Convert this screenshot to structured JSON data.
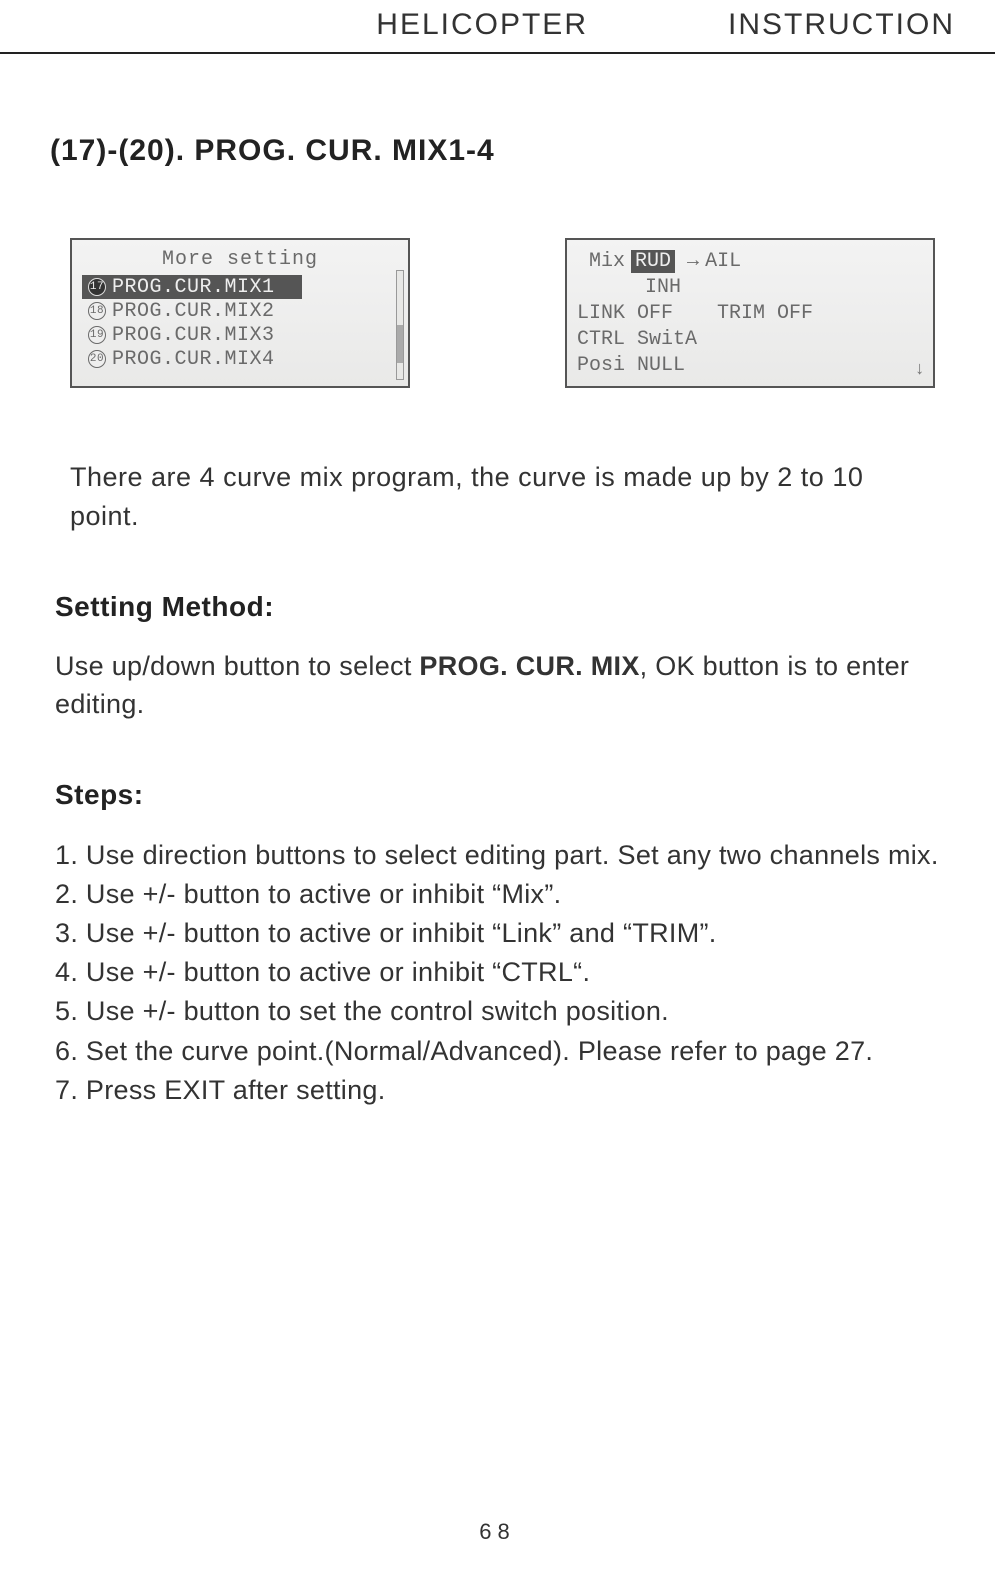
{
  "header": {
    "left": "HELICOPTER",
    "right": "INSTRUCTION"
  },
  "section_title": "(17)-(20). PROG. CUR. MIX1-4",
  "lcd_left": {
    "title": "More setting",
    "items": [
      {
        "idx": "17",
        "label": "PROG.CUR.MIX1",
        "selected": true
      },
      {
        "idx": "18",
        "label": "PROG.CUR.MIX2",
        "selected": false
      },
      {
        "idx": "19",
        "label": "PROG.CUR.MIX3",
        "selected": false
      },
      {
        "idx": "20",
        "label": "PROG.CUR.MIX4",
        "selected": false
      }
    ]
  },
  "lcd_right": {
    "mix_label": "Mix",
    "mix_from": "RUD",
    "mix_to": "AIL",
    "inh": "INH",
    "link_label": "LINK",
    "link_val": "OFF",
    "trim_label": "TRIM",
    "trim_val": "OFF",
    "ctrl_label": "CTRL",
    "ctrl_val": "SwitA",
    "posi_label": "Posi",
    "posi_val": "NULL"
  },
  "intro": "There are 4 curve mix program, the curve is made up by 2 to 10 point.",
  "setting_method_head": "Setting Method:",
  "setting_method_text_pre": "Use up/down button to select ",
  "setting_method_bold": "PROG. CUR. MIX",
  "setting_method_text_post": ", OK button  is to enter editing.",
  "steps_head": "Steps:",
  "steps": [
    "1. Use direction buttons to select editing part. Set any two channels mix.",
    "2. Use +/- button to active or inhibit “Mix”.",
    "3. Use +/- button to active or inhibit “Link” and “TRIM”.",
    "4. Use +/- button to active or inhibit  “CTRL“.",
    "5. Use +/- button to set the control switch position.",
    "6. Set the curve point.(Normal/Advanced). Please refer to page 27.",
    "7. Press EXIT after setting."
  ],
  "page_number": "68"
}
